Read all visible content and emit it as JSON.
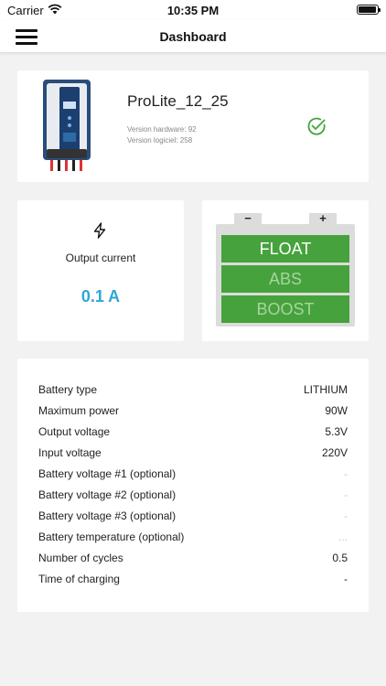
{
  "status_bar": {
    "carrier": "Carrier",
    "time": "10:35 PM"
  },
  "nav": {
    "title": "Dashboard"
  },
  "device": {
    "name": "ProLite_12_25",
    "hardware_version": "Version hardware: 92",
    "software_version": "Version logiciel: 258",
    "status_icon": "check-circle-icon",
    "status_color": "#46a23c"
  },
  "output": {
    "label": "Output current",
    "value": "0.1 A",
    "value_color": "#2fa5d6",
    "icon": "bolt-icon"
  },
  "battery_state": {
    "terminal_negative": "−",
    "terminal_positive": "+",
    "segments": [
      {
        "label": "FLOAT",
        "active": true
      },
      {
        "label": "ABS",
        "active": false
      },
      {
        "label": "BOOST",
        "active": false
      }
    ],
    "active_color": "#46a23c"
  },
  "info": {
    "rows": [
      {
        "label": "Battery type",
        "value": "LITHIUM",
        "muted": false
      },
      {
        "label": "Maximum power",
        "value": "90W",
        "muted": false
      },
      {
        "label": "Output voltage",
        "value": "5.3V",
        "muted": false
      },
      {
        "label": "Input voltage",
        "value": "220V",
        "muted": false
      },
      {
        "label": "Battery voltage #1 (optional)",
        "value": "-",
        "muted": true
      },
      {
        "label": "Battery voltage #2 (optional)",
        "value": "-",
        "muted": true
      },
      {
        "label": "Battery voltage #3 (optional)",
        "value": "-",
        "muted": true
      },
      {
        "label": "Battery temperature (optional)",
        "value": "...",
        "muted": true
      },
      {
        "label": "Number of cycles",
        "value": "0.5",
        "muted": false
      },
      {
        "label": "Time of charging",
        "value": "-",
        "muted": false
      }
    ]
  }
}
